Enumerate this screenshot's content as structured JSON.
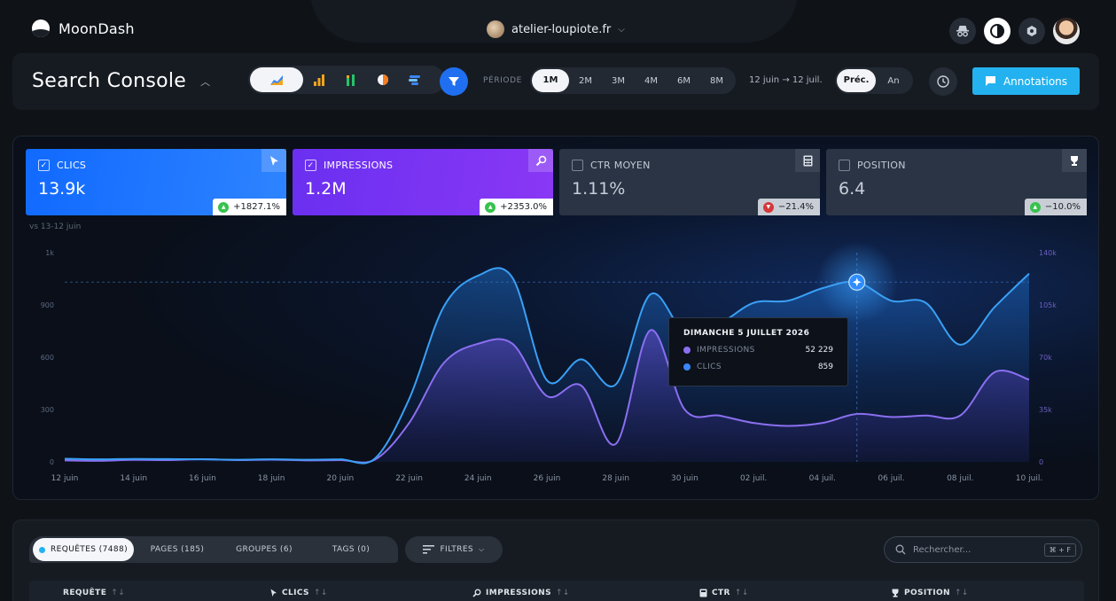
{
  "app": {
    "name": "MoonDash"
  },
  "site": {
    "name": "atelier-loupiote.fr"
  },
  "header": {
    "title": "Search Console",
    "periode_label": "PÉRIODE",
    "periods": [
      "1M",
      "2M",
      "3M",
      "4M",
      "6M",
      "8M"
    ],
    "active_period": "1M",
    "range": "12 juin → 12 juil.",
    "compare": [
      "Préc.",
      "An"
    ],
    "active_compare": "Préc.",
    "annotations_label": "Annotations"
  },
  "metrics": [
    {
      "label": "CLICS",
      "value": "13.9k",
      "delta": "+1827.1%",
      "checked": true,
      "direction": "up"
    },
    {
      "label": "IMPRESSIONS",
      "value": "1.2M",
      "delta": "+2353.0%",
      "checked": true,
      "direction": "up"
    },
    {
      "label": "CTR MOYEN",
      "value": "1.11%",
      "delta": "−21.4%",
      "checked": false,
      "direction": "down"
    },
    {
      "label": "POSITION",
      "value": "6.4",
      "delta": "−10.0%",
      "checked": false,
      "direction": "up"
    }
  ],
  "vs_label": "vs 13-12 juin",
  "tooltip": {
    "title": "DIMANCHE 5 JUILLET 2026",
    "rows": [
      {
        "label": "IMPRESSIONS",
        "value": "52 229"
      },
      {
        "label": "CLICS",
        "value": "859"
      }
    ]
  },
  "colors": {
    "clicks": "#3aa0f5",
    "impressions": "#8b6ff0",
    "accent": "#23b2ef",
    "filter": "#1f6ff0"
  },
  "chart_data": {
    "type": "area",
    "x": [
      "12 juin",
      "13 juin",
      "14 juin",
      "15 juin",
      "16 juin",
      "17 juin",
      "18 juin",
      "19 juin",
      "20 juin",
      "21 juin",
      "22 juin",
      "23 juin",
      "24 juin",
      "25 juin",
      "26 juin",
      "27 juin",
      "28 juin",
      "29 juin",
      "30 juin",
      "01 juil.",
      "02 juil.",
      "03 juil.",
      "04 juil.",
      "05 juil.",
      "06 juil.",
      "07 juil.",
      "08 juil.",
      "09 juil.",
      "10 juil."
    ],
    "x_tick_labels": [
      "12 juin",
      "14 juin",
      "16 juin",
      "18 juin",
      "20 juin",
      "22 juin",
      "24 juin",
      "26 juin",
      "28 juin",
      "30 juin",
      "02 juil.",
      "04 juil.",
      "06 juil.",
      "08 juil.",
      "10 juil."
    ],
    "series": [
      {
        "name": "CLICS",
        "axis": "left",
        "values": [
          15,
          12,
          14,
          13,
          12,
          10,
          12,
          10,
          12,
          15,
          300,
          740,
          890,
          880,
          390,
          490,
          370,
          800,
          620,
          660,
          760,
          770,
          830,
          859,
          770,
          760,
          560,
          740,
          900
        ]
      },
      {
        "name": "IMPRESSIONS",
        "axis": "right",
        "values": [
          1000,
          700,
          1300,
          1200,
          1800,
          1200,
          1500,
          1000,
          1200,
          1400,
          26000,
          66000,
          79000,
          79000,
          44000,
          51000,
          12000,
          88000,
          35000,
          31000,
          26000,
          24000,
          26000,
          32000,
          30000,
          31000,
          31000,
          60000,
          55000
        ]
      }
    ],
    "y_left": {
      "ticks": [
        "0",
        "300",
        "600",
        "900",
        "1k"
      ],
      "ylim": [
        0,
        1000
      ]
    },
    "y_right": {
      "ticks": [
        "0",
        "35k",
        "70k",
        "105k",
        "140k"
      ],
      "ylim": [
        0,
        140000
      ]
    },
    "highlight": "05 juil."
  },
  "table": {
    "tabs": [
      {
        "label": "REQUÊTES (7488)",
        "active": true
      },
      {
        "label": "PAGES  (185)",
        "active": false
      },
      {
        "label": "GROUPES  (6)",
        "active": false
      },
      {
        "label": "TAGS  (0)",
        "active": false
      }
    ],
    "filters_label": "FILTRES",
    "search_placeholder": "Rechercher...",
    "search_shortcut": "⌘ + F",
    "columns": [
      "REQUÊTE",
      "CLICS",
      "IMPRESSIONS",
      "CTR",
      "POSITION"
    ],
    "sort_glyph": "↑↓"
  }
}
